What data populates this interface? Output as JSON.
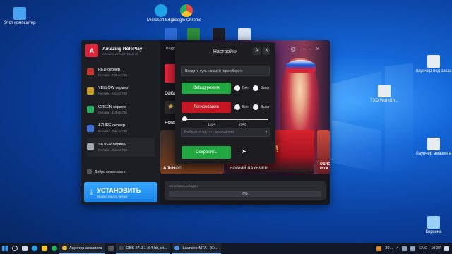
{
  "desktop": {
    "icons": [
      {
        "label": "Этот компьютер",
        "color": "#4aa3f0"
      },
      {
        "label": "Microsoft Edge",
        "color": "#1fa1e8"
      },
      {
        "label": "Google Chrome",
        "color": "#f2c12e"
      },
      {
        "label": "лаунчер под заказ",
        "color": "#e8edf2"
      },
      {
        "label": "TXD WorkSh...",
        "color": "#e8edf2"
      },
      {
        "label": "Лаунчер амазинга",
        "color": "#e8edf2"
      },
      {
        "label": "Корзина",
        "color": "#9ad0f5"
      }
    ]
  },
  "launcher": {
    "brand_name": "Amazing RolePlay",
    "brand_sub": "СЕРВИС ИГРАЕТ ТВОЙ ПК",
    "top_tab": "Веду",
    "servers": [
      {
        "name": "RED сервер",
        "online": "Онлайн: 372 из 750",
        "color": "#c0392b"
      },
      {
        "name": "YELLOW сервер",
        "online": "Онлайн: 231 из 750",
        "color": "#c9a227"
      },
      {
        "name": "GREEN сервер",
        "online": "Онлайн: 418 из 750",
        "color": "#27ae60"
      },
      {
        "name": "AZURE сервер",
        "online": "Онлайн: 251 из 750",
        "color": "#3b6fd6"
      },
      {
        "name": "SILVER сервер",
        "online": "Онлайн: 251 из 750",
        "color": "#a7a7b0"
      }
    ],
    "welcome": "Добро пожаловать",
    "install_title": "УСТАНОВИТЬ",
    "install_sub": "Может занять время",
    "news_label1": "СОБЫ",
    "news_label2": "НОВО",
    "card1_title": "АЛЬНОЕ",
    "card2_title": "НОВЫЙ ЛАУНЧЕР",
    "card2_big": "РЯ!",
    "card3_title": "ОБНО РОЖ",
    "status_text": "нет активных задач",
    "progress_label": "0%",
    "progress_value": 0
  },
  "settings": {
    "title": "Настройки",
    "btn_a": "A",
    "btn_x": "X",
    "path_placeholder": "Введите путь к вашей игре(сборке)",
    "debug_label": "Debug режим",
    "log_label": "Логирование",
    "on_label": "Вкл",
    "off_label": "Выкл",
    "slider_min": "1024",
    "slider_max": "2048",
    "mic_placeholder": "Выберите частоту микрофона",
    "save_label": "Сохранить"
  },
  "taskbar": {
    "tasks": [
      {
        "label": "Лаунчер амазинга",
        "color": "#f0c23a"
      },
      {
        "label": "OBS 27.0.1 (64-bit, wi...",
        "color": "#444b57"
      },
      {
        "label": "-LauncherMTA - [C:...",
        "color": "#4a8fe8"
      }
    ],
    "weather": "30...",
    "lang": "ENG",
    "time": "19:37"
  }
}
